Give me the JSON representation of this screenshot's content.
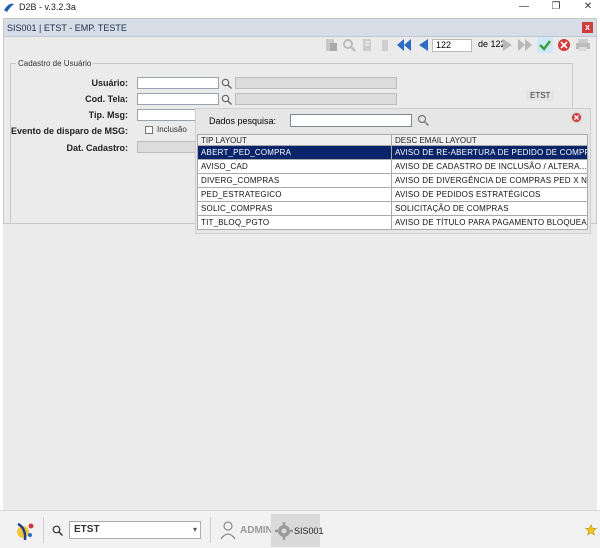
{
  "window": {
    "title": "D2B - v.3.2.3a",
    "minimize_glyph": "—",
    "restore_glyph": "❐",
    "close_glyph": "✕"
  },
  "form": {
    "title": "SIS001 | ETST - EMP. TESTE",
    "close_glyph": "x",
    "toolbar": {
      "page_current": "122",
      "page_of": "de 122",
      "icons": [
        "paste-icon",
        "search-icon",
        "document-icon",
        "delete-icon",
        "first-record-icon",
        "prev-record-icon",
        "next-record-icon",
        "last-record-icon",
        "confirm-icon",
        "cancel-icon",
        "print-icon"
      ]
    },
    "fieldset_legend": "Cadastro de Usuário",
    "labels": {
      "usuario": "Usuário:",
      "cod_tela": "Cod. Tela:",
      "tip_msg": "Tip. Msg:",
      "evento": "Evento de disparo de MSG:",
      "dat_cadastro": "Dat. Cadastro:"
    },
    "checkbox_inclusao": "Inclusão",
    "company_tag": "ETST"
  },
  "popup": {
    "search_label": "Dados pesquisa:",
    "search_value": "",
    "columns": [
      "TIP LAYOUT",
      "DESC EMAIL LAYOUT"
    ],
    "rows": [
      [
        "ABERT_PED_COMPRA",
        "AVISO DE RE-ABERTURA DE PEDIDO DE COMPRA"
      ],
      [
        "AVISO_CAD",
        "AVISO DE CADASTRO DE INCLUSÃO / ALTERA..."
      ],
      [
        "DIVERG_COMPRAS",
        "AVISO DE DIVERGÊNCIA DE COMPRAS PED X NF"
      ],
      [
        "PED_ESTRATEGICO",
        "AVISO DE PEDIDOS ESTRATÉGICOS"
      ],
      [
        "SOLIC_COMPRAS",
        "SOLICITAÇÃO DE COMPRAS"
      ],
      [
        "TIT_BLOQ_PGTO",
        "AVISO DE TÍTULO PARA PAGAMENTO BLOQUEA..."
      ]
    ],
    "selected_row": 0
  },
  "taskbar": {
    "company_value": "ETST",
    "combo_arrow": "▾",
    "user": "ADMIN",
    "module": "SIS001"
  },
  "colors": {
    "selection": "#0a246a",
    "confirm_green": "#3aa13a",
    "cancel_red": "#d03b3b",
    "nav_blue": "#2b6cc4"
  }
}
